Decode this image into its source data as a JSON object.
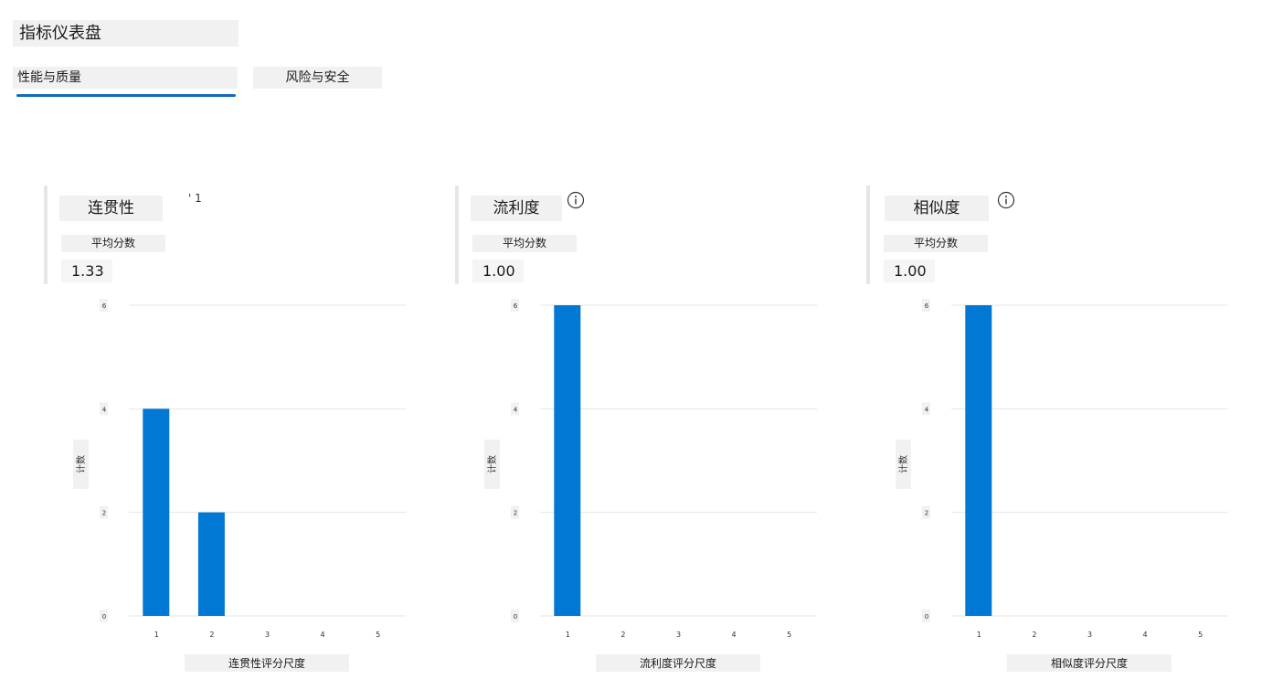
{
  "header": {
    "title": "指标仪表盘",
    "tabs": [
      {
        "label": "性能与质量",
        "active": true
      },
      {
        "label": "风险与安全",
        "active": false
      }
    ]
  },
  "colors": {
    "bar": "#0078d4",
    "accent": "#0f6cbd",
    "grid": "#e6e6e6"
  },
  "panels": [
    {
      "title": "连贯性",
      "title_marker": "' 1",
      "avg_label": "平均分数",
      "avg_value": "1.33",
      "icon": "info-icon",
      "ylabel": "计数",
      "xlabel": "连贯性评分尺度"
    },
    {
      "title": "流利度",
      "avg_label": "平均分数",
      "avg_value": "1.00",
      "icon": "info-icon",
      "ylabel": "计数",
      "xlabel": "流利度评分尺度"
    },
    {
      "title": "相似度",
      "avg_label": "平均分数",
      "avg_value": "1.00",
      "icon": "info-icon",
      "ylabel": "计数",
      "xlabel": "相似度评分尺度"
    }
  ],
  "chart_data": [
    {
      "type": "bar",
      "categories": [
        "1",
        "2",
        "3",
        "4",
        "5"
      ],
      "values": [
        4,
        2,
        0,
        0,
        0
      ],
      "ylim": [
        0,
        6
      ],
      "yticks": [
        "0",
        "2",
        "4",
        "6"
      ],
      "ylabel": "计数",
      "xlabel": "连贯性评分尺度",
      "grid": true
    },
    {
      "type": "bar",
      "categories": [
        "1",
        "2",
        "3",
        "4",
        "5"
      ],
      "values": [
        6,
        0,
        0,
        0,
        0
      ],
      "ylim": [
        0,
        6
      ],
      "yticks": [
        "0",
        "2",
        "4",
        "6"
      ],
      "ylabel": "计数",
      "xlabel": "流利度评分尺度",
      "grid": true
    },
    {
      "type": "bar",
      "categories": [
        "1",
        "2",
        "3",
        "4",
        "5"
      ],
      "values": [
        6,
        0,
        0,
        0,
        0
      ],
      "ylim": [
        0,
        6
      ],
      "yticks": [
        "0",
        "2",
        "4",
        "6"
      ],
      "ylabel": "计数",
      "xlabel": "相似度评分尺度",
      "grid": true
    }
  ]
}
